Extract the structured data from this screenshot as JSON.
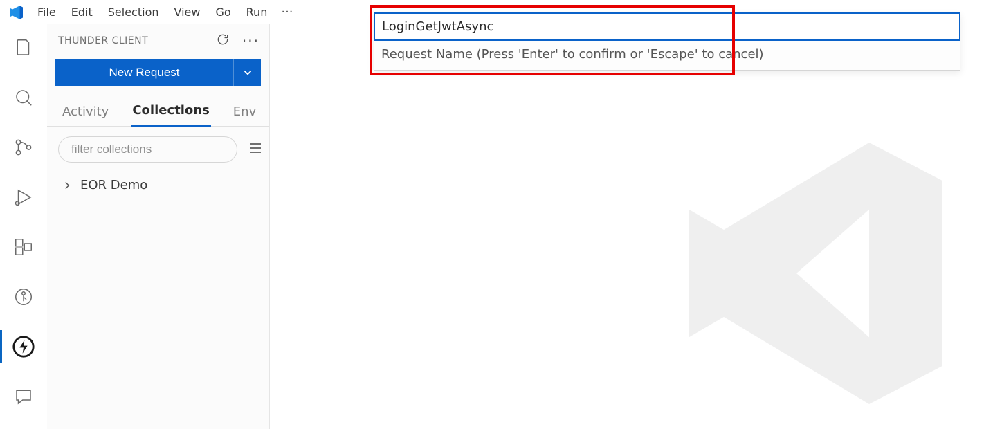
{
  "menu": {
    "items": [
      "File",
      "Edit",
      "Selection",
      "View",
      "Go",
      "Run"
    ],
    "overflow": "···"
  },
  "sidebar": {
    "title": "THUNDER CLIENT",
    "newRequest": "New Request",
    "tabs": {
      "activity": "Activity",
      "collections": "Collections",
      "env": "Env"
    },
    "filterPlaceholder": "filter collections",
    "tree": {
      "item0": "EOR Demo"
    }
  },
  "quickInput": {
    "value": "LoginGetJwtAsync",
    "hint": "Request Name (Press 'Enter' to confirm or 'Escape' to cancel)"
  }
}
